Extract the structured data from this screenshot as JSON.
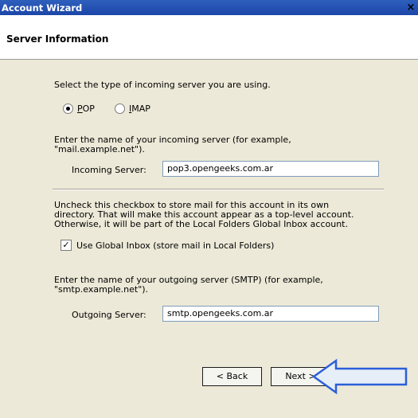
{
  "window": {
    "title": "Account Wizard",
    "close_glyph": "×"
  },
  "header": {
    "title": "Server Information"
  },
  "incoming": {
    "prompt": "Select the type of incoming server you are using.",
    "options": [
      {
        "label": "POP",
        "selected": true
      },
      {
        "label": "IMAP",
        "selected": false
      }
    ],
    "instruction_line1": "Enter the name of your incoming server (for example,",
    "instruction_line2": "\"mail.example.net\").",
    "field_label": "Incoming Server:",
    "field_value": "pop3.opengeeks.com.ar"
  },
  "global_inbox": {
    "text_line1": "Uncheck this checkbox to store mail for this account in its own",
    "text_line2": "directory. That will make this account appear as a top-level account.",
    "text_line3": "Otherwise, it will be part of the Local Folders Global Inbox account.",
    "checkbox_label": "Use Global Inbox (store mail in Local Folders)",
    "checked": true
  },
  "outgoing": {
    "instruction_line1": "Enter the name of your outgoing server (SMTP) (for example,",
    "instruction_line2": "\"smtp.example.net\").",
    "field_label": "Outgoing Server:",
    "field_value": "smtp.opengeeks.com.ar"
  },
  "buttons": {
    "back": "< Back",
    "next": "Next >"
  },
  "annotation": {
    "arrow_color": "#2b5fd9",
    "arrow_fill": "#e6eef8"
  }
}
